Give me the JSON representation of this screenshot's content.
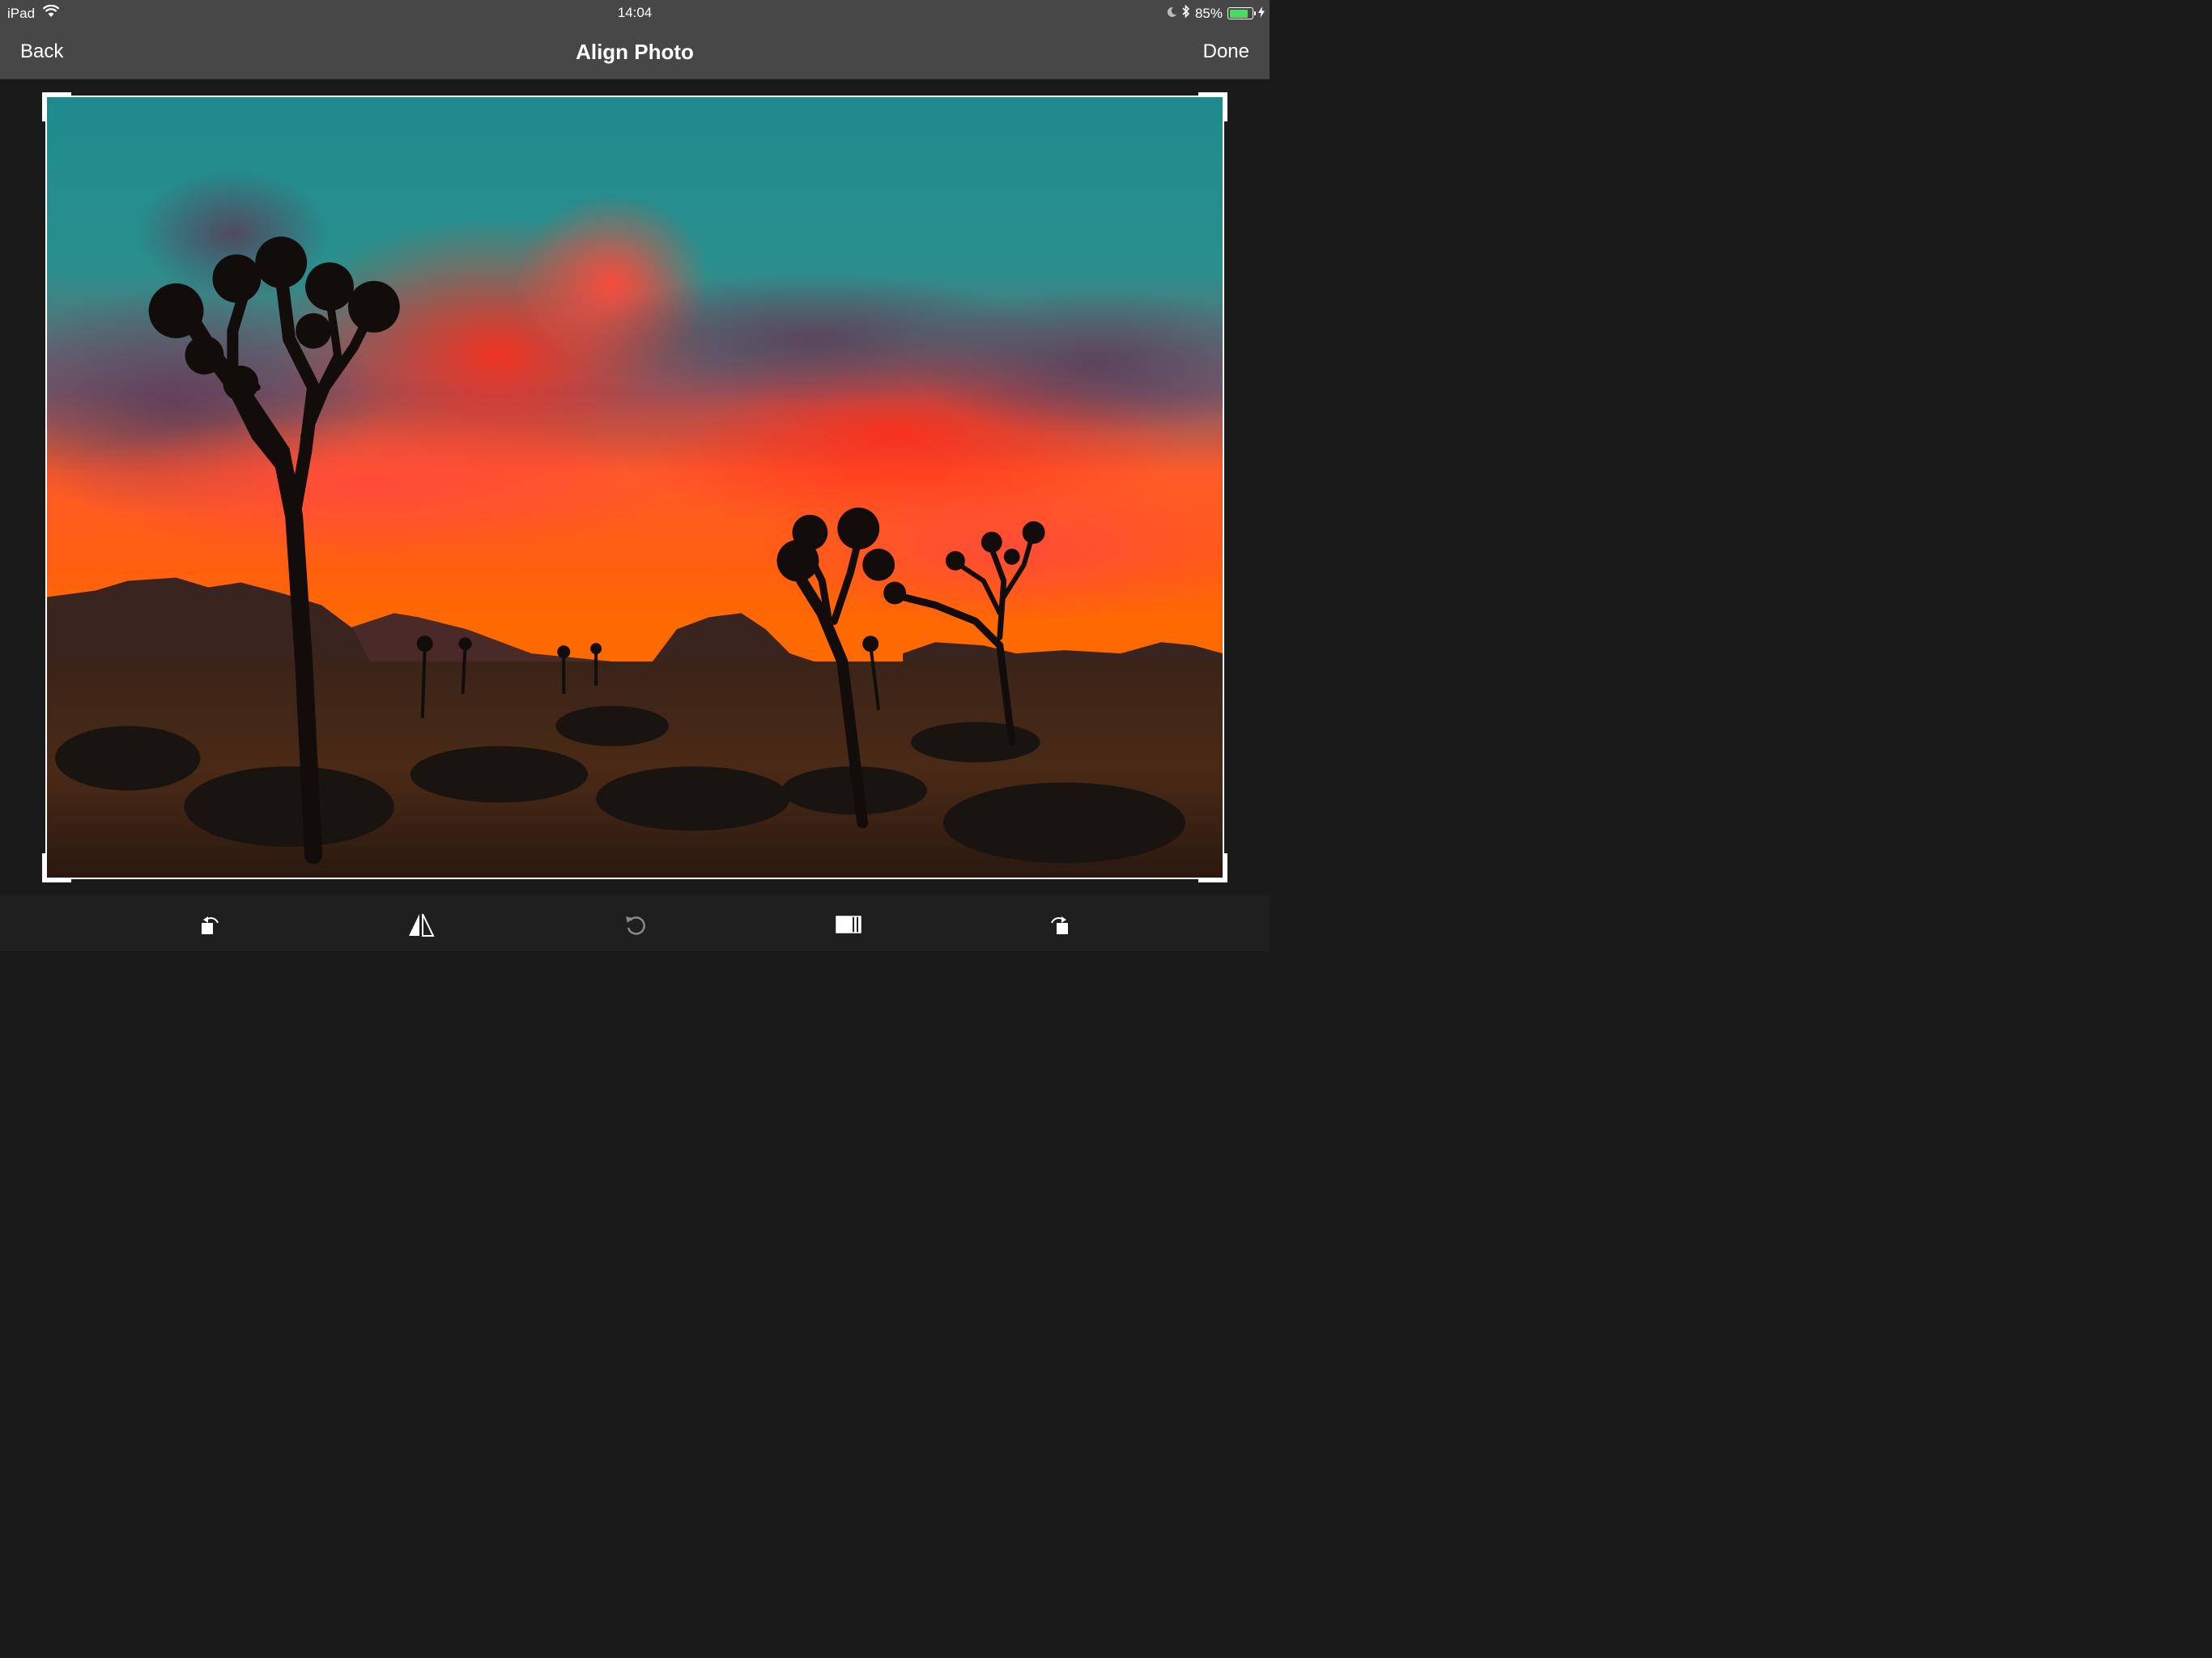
{
  "status_bar": {
    "device": "iPad",
    "time": "14:04",
    "battery_percent": "85%",
    "battery_level": 0.85,
    "battery_color": "#4cd964"
  },
  "nav": {
    "back_label": "Back",
    "title": "Align Photo",
    "done_label": "Done"
  },
  "toolbar": {
    "tools": [
      {
        "name": "rotate-left",
        "icon": "rotate-left-icon",
        "enabled": true
      },
      {
        "name": "flip",
        "icon": "flip-horizontal-icon",
        "enabled": true
      },
      {
        "name": "reset",
        "icon": "undo-rotate-icon",
        "enabled": false
      },
      {
        "name": "aspect-ratio",
        "icon": "aspect-ratio-icon",
        "enabled": true
      },
      {
        "name": "rotate-right",
        "icon": "rotate-right-icon",
        "enabled": true
      }
    ]
  },
  "colors": {
    "bar_background": "#474747",
    "editor_background": "#1a1a1a",
    "toolbar_background": "#1f1f1f"
  }
}
